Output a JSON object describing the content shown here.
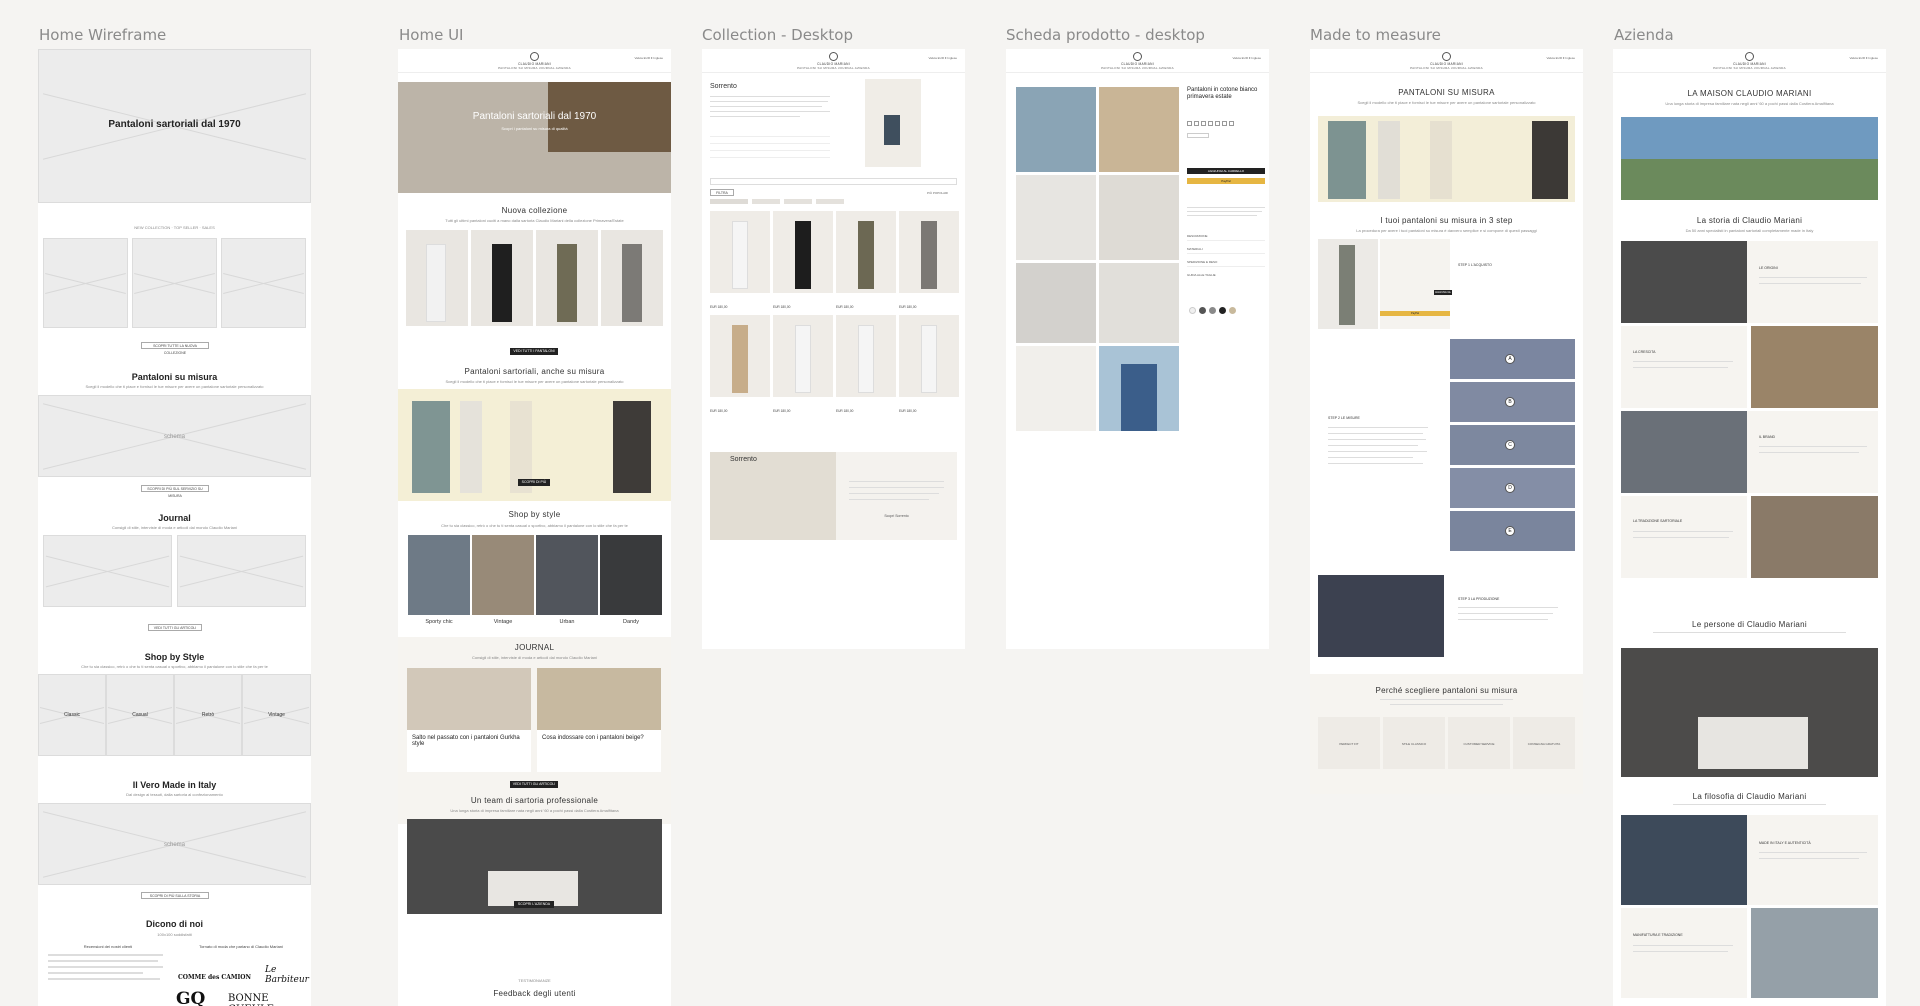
{
  "frames": [
    {
      "id": "wireframe",
      "title": "Home Wireframe"
    },
    {
      "id": "homeui",
      "title": "Home UI"
    },
    {
      "id": "collection",
      "title": "Collection - Desktop"
    },
    {
      "id": "product",
      "title": "Scheda prodotto - desktop"
    },
    {
      "id": "measure",
      "title": "Made to measure"
    },
    {
      "id": "azienda",
      "title": "Azienda"
    }
  ],
  "wireframe": {
    "hero_title": "Pantaloni sartoriali dal 1970",
    "tabs": "NEW COLLECTION · TOP SELLER · SALES",
    "products_button": "SCOPRI TUTTE LA NUOVA COLLEZIONE",
    "measure_title": "Pantaloni su misura",
    "measure_sub": "Scegli il modello che ti piace e fornisci le tue misure per avere un pantalone sartoriale personalizzato",
    "schema_label": "schema",
    "measure_button": "SCOPRI DI PIÙ SUL SERVIZIO SU MISURA",
    "journal_title": "Journal",
    "journal_sub": "Consigli di stile, interviste di moda e articoli dal mondo Claudio Mariani",
    "journal_button": "VEDI TUTTI GLI ARTICOLI",
    "style_title": "Shop by Style",
    "style_sub": "Che tu sia classico, retrò o che tu ti senta casual o sportivo, abbiamo il pantalone con lo stile che fa per te",
    "styles": [
      "Classic",
      "Casual",
      "Retrò",
      "Vintage"
    ],
    "italy_title": "Il Vero Made in Italy",
    "italy_sub": "Dal design ai tessuti, dalla sartoria al confezionamento",
    "italy_button": "SCOPRI DI PIÙ SULLA STORIA",
    "reviews_title": "Dicono di noi",
    "reviews_sub": "100x100 soddisfatti",
    "reviews_left": "Recensioni dei nostri clienti",
    "reviews_right": "Tornato di moda che parlano di Claudio Mariani",
    "brands": [
      "COMME des CAMION",
      "Le Barbiteur",
      "GQ",
      "BONNE GUEULE"
    ]
  },
  "homeui": {
    "brand": "CLAUDIO MARIANI",
    "nav": "PANTALONI   SU MISURA   JOURNAL   AZIENDA",
    "header_right": "Valuta  EUR €   Inglese",
    "hero_title": "Pantaloni sartoriali dal 1970",
    "hero_sub": "Scopri i pantaloni su misura di qualità",
    "collection_title": "Nuova collezione",
    "collection_sub": "Tutti gli ultimi pantaloni cuciti a mano dalla sartoria Claudio Mariani della collezione Primavera/Estate",
    "collection_button": "VEDI TUTTI I PANTALONI",
    "measure_title": "Pantaloni sartoriali, anche su misura",
    "measure_sub": "Scegli il modello che ti piace e fornisci le tue misure per avere un pantalone sartoriale personalizzato",
    "measure_button": "SCOPRI DI PIÙ",
    "style_title": "Shop by style",
    "style_sub": "Che tu sia classico, retrò o che tu ti senta casual o sportivo, abbiamo il pantalone con lo stile che fa per te",
    "styles": [
      "Sporty chic",
      "Vintage",
      "Urban",
      "Dandy"
    ],
    "journal_title": "JOURNAL",
    "journal_sub": "Consigli di stile, interviste di moda e articoli dal mondo Claudio Mariani",
    "articles": [
      "Salto nel passato con i pantaloni Gurkha style",
      "Cosa indossare con i pantaloni beige?"
    ],
    "journal_button": "VEDI TUTTI GLI ARTICOLI",
    "team_title": "Un team di sartoria professionale",
    "team_sub": "Una lunga storia di impresa familiare nata negli anni '60 a pochi passi dalla Costiera Amalfitana",
    "team_button": "SCOPRI L'AZIENDA",
    "testimonials_label": "TESTIMONIANZE",
    "testimonials_title": "Feedback degli utenti"
  },
  "collection": {
    "title": "Sorrento",
    "filter_label": "FILTRA",
    "sort_label": "PIÙ POPOLARI",
    "map_label": "Sorrento",
    "map_button": "Scopri Sorrento",
    "price": "EUR 180,00"
  },
  "product": {
    "title": "Pantaloni in cotone bianco primavera estate",
    "cart_button": "AGGIUNGI AL CARRELLO",
    "pay_button": "PayPal",
    "sections": [
      "DESCRIZIONE",
      "MATERIALI",
      "SPEDIZIONE E RESO",
      "GUIDA ALLE TAGLIE"
    ]
  },
  "measure": {
    "title": "PANTALONI SU MISURA",
    "sub": "Scegli il modello che ti piace e fornisci le tue misure per avere un pantalone sartoriale personalizzato",
    "steps_title": "I tuoi pantaloni su misura in 3 step",
    "steps_sub": "La procedura per avere i tuoi pantaloni su misura è davvero semplice e si compone di questi passaggi",
    "step_labels": [
      "STEP 1 L'ACQUISTO",
      "STEP 2 LE MISURE",
      "STEP 3 LA PRODUZIONE"
    ],
    "letters": [
      "A",
      "B",
      "C",
      "D",
      "E"
    ],
    "why_title": "Perché scegliere pantaloni su misura",
    "features": [
      "PERFECT FIT",
      "STILE CLASSICO",
      "CUSTOMER SERVICE",
      "CONSEGNA GRATUITA"
    ]
  },
  "azienda": {
    "title": "LA MAISON CLAUDIO MARIANI",
    "sub": "Una lunga storia di impresa familiare nata negli anni '60 a pochi passi dalla Costiera Amalfitana",
    "story_title": "La storia di Claudio Mariani",
    "story_sub": "Da 50 anni specialisti in pantaloni sartoriali completamente made in Italy",
    "chapters": [
      "LE ORIGINI",
      "LA CRESCITA",
      "IL BRAND",
      "LA TRADIZIONE SARTORIALE"
    ],
    "people_title": "Le persone di Claudio Mariani",
    "philosophy_title": "La filosofia di Claudio Mariani",
    "philosophy_items": [
      "MADE IN ITALY E AUTENTICITÀ",
      "MANIFATTURA E TRADIZIONE"
    ]
  }
}
